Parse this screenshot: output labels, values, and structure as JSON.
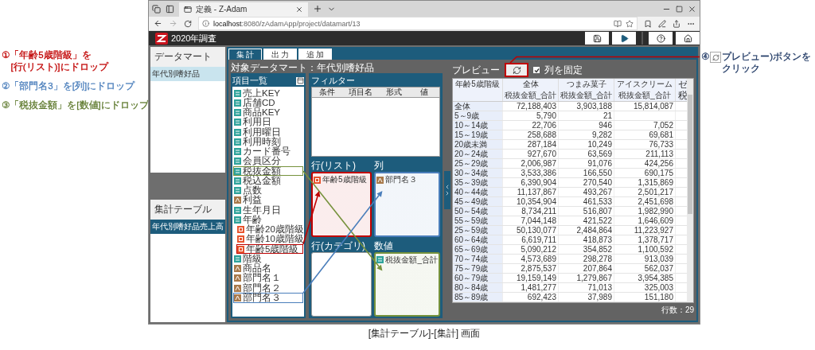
{
  "annotations": [
    {
      "kind": "plain",
      "lines": [
        "①「年齢5歳階級」を",
        "[行(リスト)]にドロップ"
      ],
      "color": "#c00000"
    },
    {
      "kind": "plain",
      "lines": [
        "②「部門名3」を[列]にドロップ"
      ],
      "color": "#4a7ebb"
    },
    {
      "kind": "plain",
      "lines": [
        "③「税抜金額」を[数値]にドロップ"
      ],
      "color": "#5f7a2e"
    },
    {
      "kind": "with-icon",
      "prefix": "④",
      "lines": [
        "プレビュー)ボタンを",
        "クリック"
      ],
      "color": "#1f3864"
    }
  ],
  "browser": {
    "tab_title": "定義 - Z-Adam",
    "url": "**localhost**:8080/zAdamApp/project/datamart/13"
  },
  "app": {
    "title": "2020年調査"
  },
  "sidebar": [
    {
      "heading": "データマート",
      "active": false,
      "items": [
        {
          "label": "年代別嗜好品",
          "selected": true
        }
      ]
    },
    {
      "heading": "集計テーブル",
      "active": true,
      "items": [
        {
          "label": "年代別嗜好品売上高",
          "selected": true
        }
      ]
    }
  ],
  "main_tabs": [
    {
      "label": "集 計",
      "selected": true
    },
    {
      "label": "出 力",
      "selected": false
    },
    {
      "label": "追 加",
      "selected": false
    }
  ],
  "target_datamart": "対象データマート：年代別嗜好品",
  "field_list": {
    "heading": "項目一覧",
    "items": [
      {
        "label": "売上KEY",
        "kind": "number"
      },
      {
        "label": "店舗CD",
        "kind": "number"
      },
      {
        "label": "商品KEY",
        "kind": "number"
      },
      {
        "label": "利用日",
        "kind": "number"
      },
      {
        "label": "利用曜日",
        "kind": "number"
      },
      {
        "label": "利用時刻",
        "kind": "number"
      },
      {
        "label": "カード番号",
        "kind": "number"
      },
      {
        "label": "会員区分",
        "kind": "number"
      },
      {
        "label": "税抜金額",
        "kind": "number",
        "color": "#76923c"
      },
      {
        "label": "税込金額",
        "kind": "number"
      },
      {
        "label": "点数",
        "kind": "number"
      },
      {
        "label": "利益",
        "kind": "text"
      },
      {
        "label": "生年月日",
        "kind": "number"
      },
      {
        "label": "年齢",
        "kind": "number",
        "children": [
          {
            "label": "年齢20歳階級",
            "kind": "category"
          },
          {
            "label": "年齢10歳階級",
            "kind": "category"
          },
          {
            "label": "年齢5歳階級",
            "kind": "category",
            "color": "#c00000"
          }
        ]
      },
      {
        "label": "階級",
        "kind": "number"
      },
      {
        "label": "商品名",
        "kind": "text"
      },
      {
        "label": "部門名１",
        "kind": "text"
      },
      {
        "label": "部門名２",
        "kind": "text"
      },
      {
        "label": "部門名３",
        "kind": "text",
        "color": "#4a7ebb"
      }
    ]
  },
  "filter": {
    "heading": "フィルター",
    "columns": [
      "条件",
      "項目名",
      "形式",
      "値"
    ]
  },
  "drop_zones": [
    {
      "heading": "行(リスト)",
      "color": "#c00000",
      "items": [
        {
          "label": "年齢5歳階級",
          "kind": "category"
        }
      ]
    },
    {
      "heading": "列",
      "color": "#4a7ebb",
      "items": [
        {
          "label": "部門名３",
          "kind": "text"
        }
      ]
    },
    {
      "heading": "行(カテゴリ)"
    },
    {
      "heading": "数値",
      "color": "#76923c",
      "items": [
        {
          "label": "税抜金額_合計",
          "kind": "number"
        }
      ]
    }
  ],
  "preview": {
    "label": "プレビュー",
    "refresh_button": {
      "color": "#c00000"
    },
    "fix_columns": {
      "label": "列を固定",
      "checked": true
    },
    "row_header_title": "年齢5歳階級",
    "column_groups": [
      "全体",
      "つまみ菓子",
      "アイスクリーム",
      "ゼ"
    ],
    "measures": [
      "税抜金額_合計",
      "税抜金額_合計",
      "税抜金額_合計",
      "税"
    ],
    "rows": [
      [
        "全体",
        "72,188,403",
        "3,903,188",
        "15,814,087"
      ],
      [
        "5～9歳",
        "5,790",
        "21",
        null
      ],
      [
        "10～14歳",
        "22,706",
        "946",
        "7,052"
      ],
      [
        "15～19歳",
        "258,688",
        "9,282",
        "69,681"
      ],
      [
        "20歳未満",
        "287,184",
        "10,249",
        "76,733"
      ],
      [
        "20～24歳",
        "927,670",
        "63,569",
        "211,113"
      ],
      [
        "25～29歳",
        "2,006,987",
        "91,076",
        "424,256"
      ],
      [
        "30～34歳",
        "3,533,386",
        "166,550",
        "690,175"
      ],
      [
        "35～39歳",
        "6,390,904",
        "270,540",
        "1,315,869"
      ],
      [
        "40～44歳",
        "11,137,867",
        "493,267",
        "2,501,217"
      ],
      [
        "45～49歳",
        "10,354,904",
        "461,533",
        "2,451,698"
      ],
      [
        "50～54歳",
        "8,734,211",
        "516,807",
        "1,982,990"
      ],
      [
        "55～59歳",
        "7,044,148",
        "421,522",
        "1,646,609"
      ],
      [
        "25～59歳",
        "50,130,077",
        "2,484,864",
        "11,223,927"
      ],
      [
        "60～64歳",
        "6,619,711",
        "418,873",
        "1,378,717"
      ],
      [
        "65～69歳",
        "5,090,212",
        "354,852",
        "1,100,592"
      ],
      [
        "70～74歳",
        "4,573,689",
        "298,278",
        "913,039"
      ],
      [
        "75～79歳",
        "2,875,537",
        "207,864",
        "562,037"
      ],
      [
        "60～79歳",
        "19,159,149",
        "1,279,867",
        "3,954,385"
      ],
      [
        "80～84歳",
        "1,481,277",
        "71,013",
        "325,003"
      ],
      [
        "85～89歳",
        "692,423",
        "37,989",
        "151,180"
      ]
    ],
    "row_count": "行数：29"
  },
  "caption": "[集計テーブル]-[集計] 画面"
}
